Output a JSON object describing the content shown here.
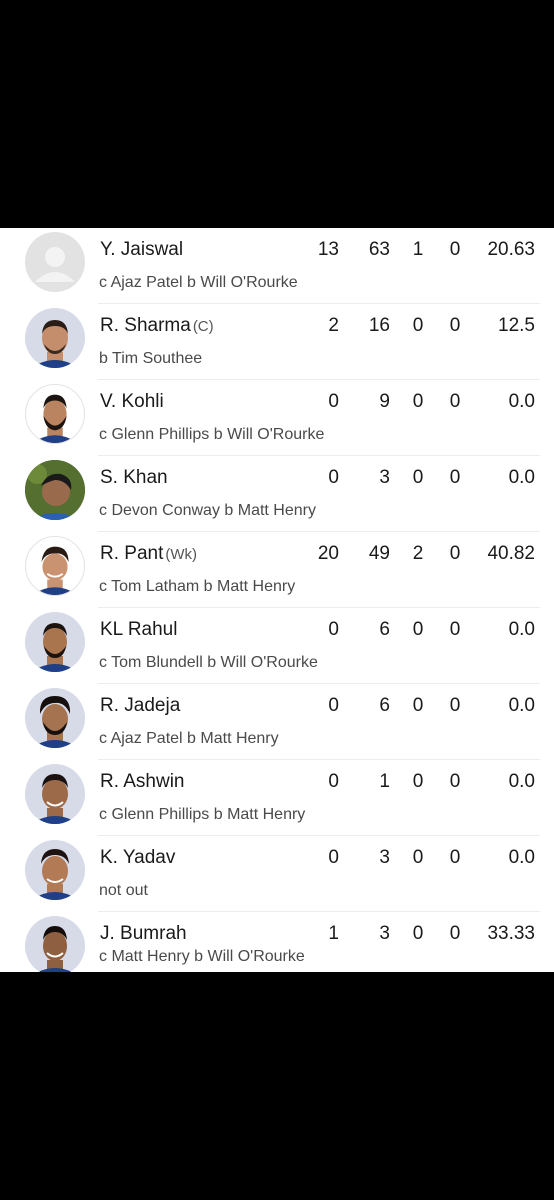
{
  "colors": {
    "background": "#000000",
    "card": "#ffffff",
    "text_primary": "#1a1a1a",
    "text_secondary": "#4a4a4a",
    "avatar_bg": "#d7dbe8",
    "placeholder_avatar": "#e2e2e2"
  },
  "batters": [
    {
      "name": "Y. Jaiswal",
      "role": "",
      "runs": "13",
      "balls": "63",
      "fours": "1",
      "sixes": "0",
      "strike_rate": "20.63",
      "dismissal": "c Ajaz Patel b Will O'Rourke",
      "avatar": "placeholder-avatar-icon"
    },
    {
      "name": "R. Sharma",
      "role": "(C)",
      "runs": "2",
      "balls": "16",
      "fours": "0",
      "sixes": "0",
      "strike_rate": "12.5",
      "dismissal": "b Tim Southee",
      "avatar": "player-photo"
    },
    {
      "name": "V. Kohli",
      "role": "",
      "runs": "0",
      "balls": "9",
      "fours": "0",
      "sixes": "0",
      "strike_rate": "0.0",
      "dismissal": "c Glenn Phillips b Will O'Rourke",
      "avatar": "player-photo"
    },
    {
      "name": "S. Khan",
      "role": "",
      "runs": "0",
      "balls": "3",
      "fours": "0",
      "sixes": "0",
      "strike_rate": "0.0",
      "dismissal": "c Devon Conway b Matt Henry",
      "avatar": "player-photo"
    },
    {
      "name": "R. Pant",
      "role": "(Wk)",
      "runs": "20",
      "balls": "49",
      "fours": "2",
      "sixes": "0",
      "strike_rate": "40.82",
      "dismissal": "c Tom Latham b Matt Henry",
      "avatar": "player-photo"
    },
    {
      "name": "KL Rahul",
      "role": "",
      "runs": "0",
      "balls": "6",
      "fours": "0",
      "sixes": "0",
      "strike_rate": "0.0",
      "dismissal": "c Tom Blundell b Will O'Rourke",
      "avatar": "player-photo"
    },
    {
      "name": "R. Jadeja",
      "role": "",
      "runs": "0",
      "balls": "6",
      "fours": "0",
      "sixes": "0",
      "strike_rate": "0.0",
      "dismissal": "c Ajaz Patel b Matt Henry",
      "avatar": "player-photo"
    },
    {
      "name": "R. Ashwin",
      "role": "",
      "runs": "0",
      "balls": "1",
      "fours": "0",
      "sixes": "0",
      "strike_rate": "0.0",
      "dismissal": "c Glenn Phillips b Matt Henry",
      "avatar": "player-photo"
    },
    {
      "name": "K. Yadav",
      "role": "",
      "runs": "0",
      "balls": "3",
      "fours": "0",
      "sixes": "0",
      "strike_rate": "0.0",
      "dismissal": "not out",
      "avatar": "player-photo"
    },
    {
      "name": "J. Bumrah",
      "role": "",
      "runs": "1",
      "balls": "3",
      "fours": "0",
      "sixes": "0",
      "strike_rate": "33.33",
      "dismissal": "c Matt Henry b Will O'Rourke",
      "avatar": "player-photo"
    }
  ]
}
